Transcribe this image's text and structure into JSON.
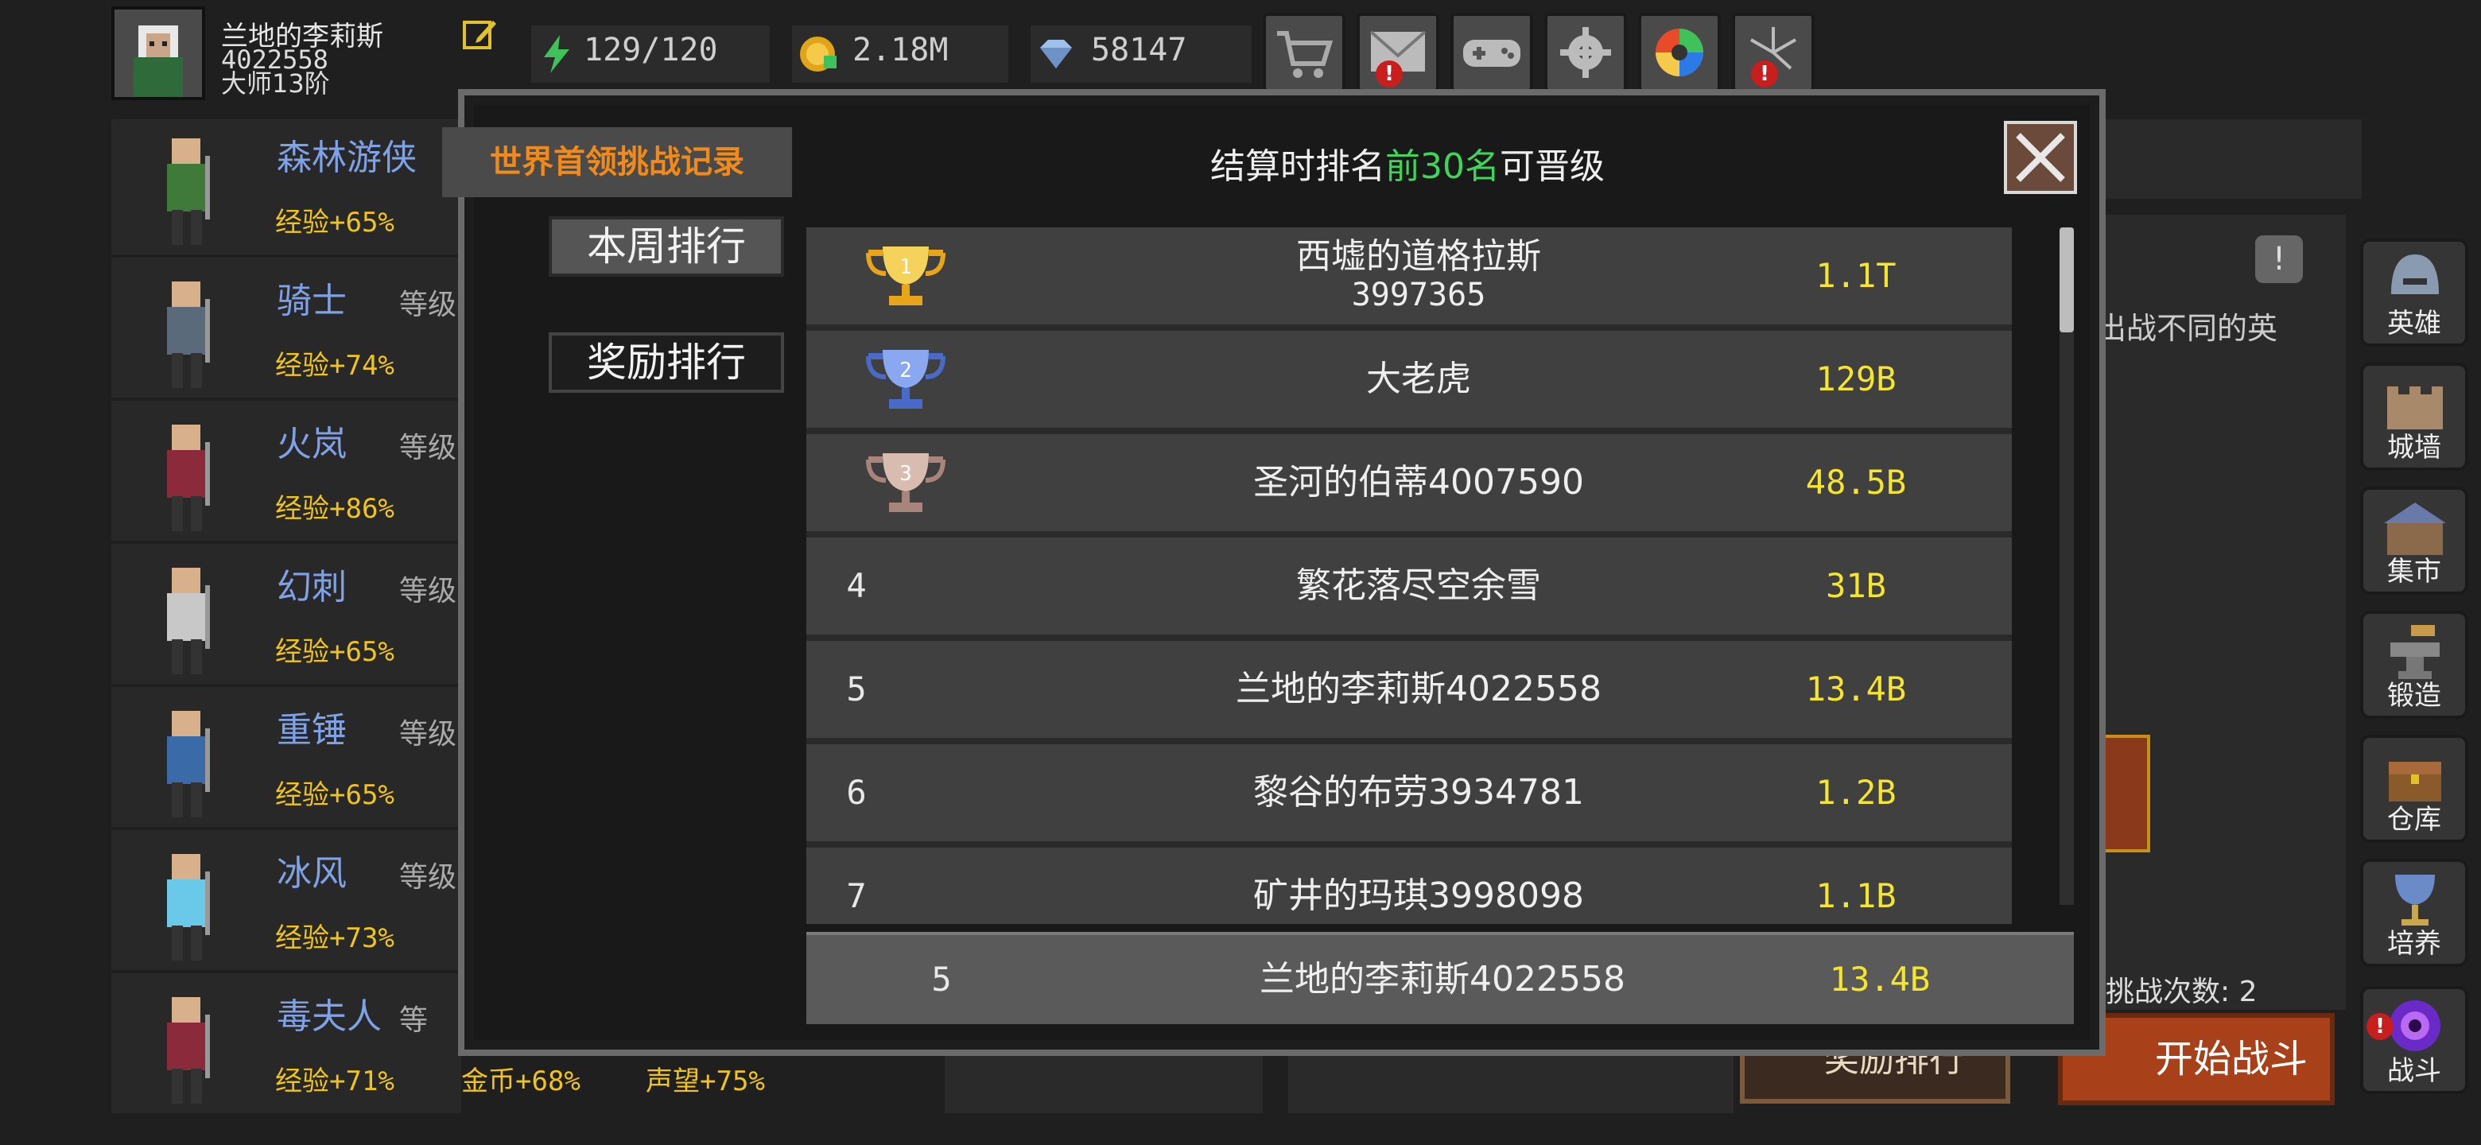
{
  "player": {
    "name": "兰地的李莉斯",
    "id": "4022558",
    "rank": "大师13阶"
  },
  "resources": {
    "energy": "129/120",
    "gold": "2.18M",
    "gems": "58147"
  },
  "top_buttons": [
    "cart-icon",
    "mail-icon",
    "gamepad-icon",
    "gear-icon",
    "color-wheel-icon",
    "fireworks-icon"
  ],
  "heroes": [
    {
      "name": "森林游侠",
      "level": "",
      "exp": "经验+65%"
    },
    {
      "name": "骑士",
      "level": "等级",
      "exp": "经验+74%"
    },
    {
      "name": "火岚",
      "level": "等级",
      "exp": "经验+86%"
    },
    {
      "name": "幻刺",
      "level": "等级",
      "exp": "经验+65%"
    },
    {
      "name": "重锤",
      "level": "等级",
      "exp": "经验+65%"
    },
    {
      "name": "冰风",
      "level": "等级",
      "exp": "经验+73%"
    },
    {
      "name": "毒夫人",
      "level": "等",
      "exp": "经验+71%",
      "gold": "金币+68%",
      "fame": "声望+75%"
    }
  ],
  "sidebar": [
    {
      "label": "英雄",
      "icon": "helmet-icon"
    },
    {
      "label": "城墙",
      "icon": "wall-icon"
    },
    {
      "label": "集市",
      "icon": "market-icon"
    },
    {
      "label": "锻造",
      "icon": "anvil-icon"
    },
    {
      "label": "仓库",
      "icon": "chest-icon"
    },
    {
      "label": "培养",
      "icon": "goblet-icon"
    },
    {
      "label": "战斗",
      "icon": "portal-icon"
    }
  ],
  "background": {
    "partial_text": "出战不同的英",
    "challenge_count": "挑战次数: 2",
    "reward_rank_button": "奖励排行",
    "start_battle_button": "开始战斗"
  },
  "modal": {
    "title": "世界首领挑战记录",
    "header_prefix": "结算时排名",
    "header_highlight": "前30名",
    "header_suffix": "可晋级",
    "tabs": [
      "本周排行",
      "奖励排行"
    ],
    "rankings": [
      {
        "rank": "1",
        "name": "西墟的道格拉斯",
        "name2": "3997365",
        "score": "1.1T",
        "cup": "gold"
      },
      {
        "rank": "2",
        "name": "大老虎",
        "name2": "",
        "score": "129B",
        "cup": "blue"
      },
      {
        "rank": "3",
        "name": "圣河的伯蒂4007590",
        "name2": "",
        "score": "48.5B",
        "cup": "bronze"
      },
      {
        "rank": "4",
        "name": "繁花落尽空余雪",
        "name2": "",
        "score": "31B",
        "cup": ""
      },
      {
        "rank": "5",
        "name": "兰地的李莉斯4022558",
        "name2": "",
        "score": "13.4B",
        "cup": ""
      },
      {
        "rank": "6",
        "name": "黎谷的布劳3934781",
        "name2": "",
        "score": "1.2B",
        "cup": ""
      },
      {
        "rank": "7",
        "name": "矿井的玛琪3998098",
        "name2": "",
        "score": "1.1B",
        "cup": ""
      }
    ],
    "my_rank": {
      "rank": "5",
      "name": "兰地的李莉斯4022558",
      "score": "13.4B"
    }
  },
  "colors": {
    "highlight_green": "#3ed65a",
    "score_yellow": "#f5e52d",
    "title_orange": "#f28a1a",
    "exp_gold": "#f0c419"
  }
}
